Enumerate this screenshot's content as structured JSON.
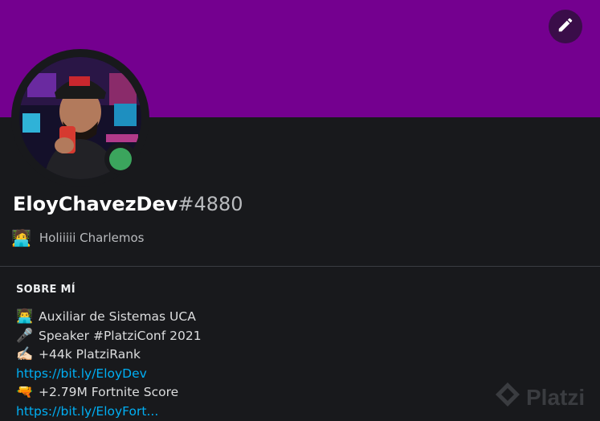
{
  "profile": {
    "username": "EloyChavezDev",
    "discriminator": "#4880",
    "status": "online",
    "custom_status": {
      "emoji": "🧑‍💻",
      "text": "Holiiiii Charlemos"
    }
  },
  "banner": {
    "color": "#74008f"
  },
  "edit_button": {
    "icon": "pencil-icon"
  },
  "about": {
    "title": "SOBRE MÍ",
    "lines": [
      {
        "emoji": "👨‍💻",
        "text": "Auxiliar de Sistemas UCA"
      },
      {
        "emoji": "🎤",
        "text": "Speaker #PlatziConf 2021"
      },
      {
        "emoji": "✍🏻",
        "text": "+44k PlatziRank"
      },
      {
        "emoji": "",
        "text": "https://bit.ly/EloyDev"
      },
      {
        "emoji": "🔫",
        "text": "+2.79M Fortnite Score"
      },
      {
        "emoji": "",
        "text": "https://bit.ly/EloyFort..."
      }
    ]
  },
  "watermark": {
    "text": "Platzi"
  },
  "colors": {
    "link": "#00aff4",
    "online": "#3ba55d",
    "background": "#18191c"
  }
}
